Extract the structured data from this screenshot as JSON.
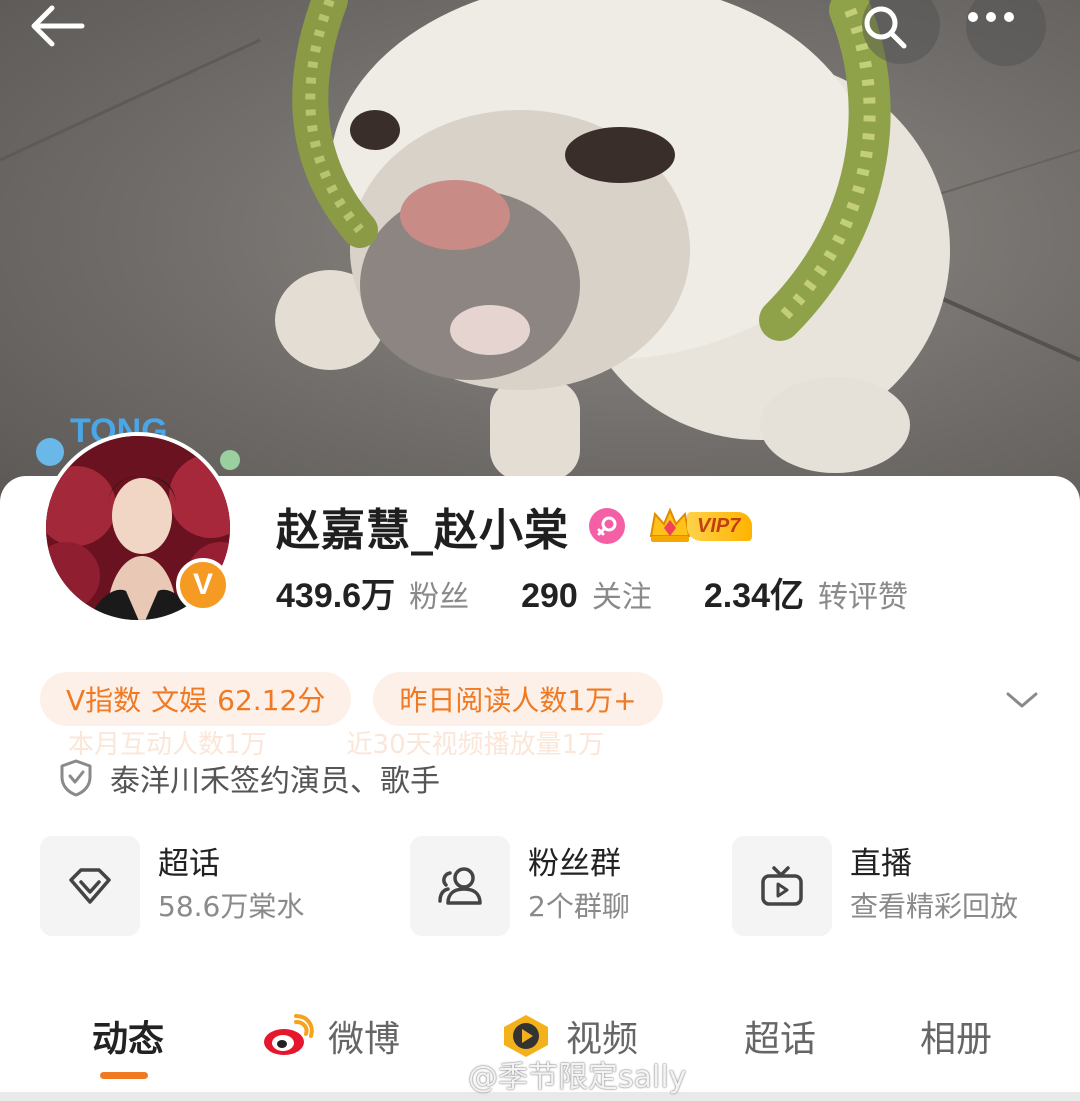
{
  "header": {
    "back_icon": "arrow-left-icon",
    "search_icon": "search-icon",
    "more_icon": "more-dots-icon"
  },
  "avatar": {
    "deco_text": "TONG",
    "verified_badge": "V"
  },
  "profile": {
    "name": "赵嘉慧_赵小棠",
    "gender_icon": "female-icon",
    "vip_label": "VIP7",
    "stats": [
      {
        "value": "439.6万",
        "label": "粉丝"
      },
      {
        "value": "290",
        "label": "关注"
      },
      {
        "value": "2.34亿",
        "label": "转评赞"
      }
    ]
  },
  "chips": {
    "v_index_label": "V指数",
    "v_index_category": "文娱",
    "v_index_score": "62.12分",
    "reads_yesterday": "昨日阅读人数1万+"
  },
  "ghost_chips": {
    "monthly_interactions": "本月互动人数1万",
    "video_plays_30d": "近30天视频播放量1万"
  },
  "certification": {
    "icon": "shield-icon",
    "text": "泰洋川禾签约演员、歌手"
  },
  "features": [
    {
      "title": "超话",
      "subtitle": "58.6万棠水",
      "icon": "supertopic-diamond-icon"
    },
    {
      "title": "粉丝群",
      "subtitle": "2个群聊",
      "icon": "group-people-icon"
    },
    {
      "title": "直播",
      "subtitle": "查看精彩回放",
      "icon": "tv-play-icon"
    }
  ],
  "tabs": [
    {
      "label": "动态",
      "active": true
    },
    {
      "label": "微博",
      "icon": "weibo-logo-icon"
    },
    {
      "label": "视频",
      "icon": "video-play-icon"
    },
    {
      "label": "超话"
    },
    {
      "label": "相册"
    }
  ],
  "watermark": {
    "text": "@季节限定sally"
  },
  "colors": {
    "accent": "#f07a24",
    "chip_bg": "#fdf0e8",
    "gender_pink": "#f45fa6",
    "verified_orange": "#f59a23"
  }
}
